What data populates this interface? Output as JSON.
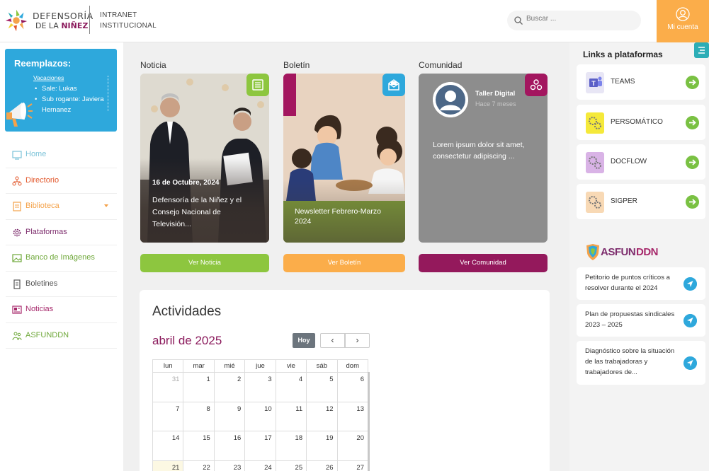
{
  "header": {
    "logo_line1": "DEFENSORÍA",
    "logo_line2_a": "DE LA",
    "logo_line2_b": "NIÑEZ",
    "intranet_line1": "INTRANET",
    "intranet_line2": "INSTITUCIONAL",
    "search_placeholder": "Buscar ...",
    "account_label": "Mi cuenta"
  },
  "reemplazos": {
    "title": "Reemplazos:",
    "subtitle": "Vacaciones",
    "items": [
      "Sale: Lukas",
      "Sub rogante: Javiera Hernanez"
    ]
  },
  "nav": {
    "items": [
      {
        "label": "Home",
        "color": "#7cc3d8"
      },
      {
        "label": "Directorio",
        "color": "#e2572b"
      },
      {
        "label": "Biblioteca",
        "color": "#f4a24a"
      },
      {
        "label": "Plataformas",
        "color": "#7d2d6d"
      },
      {
        "label": "Banco de Imágenes",
        "color": "#6fa83a"
      },
      {
        "label": "Boletines",
        "color": "#555555"
      },
      {
        "label": "Noticias",
        "color": "#a6276a"
      },
      {
        "label": "ASFUNDDN",
        "color": "#6fa83a"
      }
    ]
  },
  "cards": {
    "news": {
      "label": "Noticia",
      "date": "16 de Octubre, 2024",
      "title": "Defensoría de la Niñez y el Consejo Nacional de Televisión...",
      "button": "Ver Noticia",
      "color": "#8dc63f"
    },
    "boletin": {
      "label": "Boletín",
      "title": "Newsletter Febrero-Marzo 2024",
      "button": "Ver Boletín",
      "color": "#fbad4a"
    },
    "comunidad": {
      "label": "Comunidad",
      "author": "Taller Digital",
      "time": "Hace 7 meses",
      "text": "Lorem ipsum dolor sit amet, consectetur adipiscing ...",
      "button": "Ver Comunidad",
      "color": "#94195c"
    }
  },
  "activities": {
    "title": "Actividades",
    "month": "abril de 2025",
    "today": "Hoy",
    "prev": "‹",
    "next": "›",
    "weekdays": [
      "lun",
      "mar",
      "mié",
      "jue",
      "vie",
      "sáb",
      "dom"
    ],
    "weeks": [
      [
        "31",
        "1",
        "2",
        "3",
        "4",
        "5",
        "6"
      ],
      [
        "7",
        "8",
        "9",
        "10",
        "11",
        "12",
        "13"
      ],
      [
        "14",
        "15",
        "16",
        "17",
        "18",
        "19",
        "20"
      ],
      [
        "21",
        "22",
        "23",
        "24",
        "25",
        "26",
        "27"
      ]
    ]
  },
  "right": {
    "title": "Links a plataformas",
    "platforms": [
      {
        "label": "TEAMS",
        "color": "#e8e6f5"
      },
      {
        "label": "PERSOMÁTICO",
        "color": "#f5e93a"
      },
      {
        "label": "DOCFLOW",
        "color": "#d9b3e6"
      },
      {
        "label": "SIGPER",
        "color": "#f8d9b5"
      }
    ],
    "asfun_logo_a": "ASFUN",
    "asfun_logo_b": "DDN",
    "docs": [
      "Petitorio de puntos críticos a resolver durante el 2024",
      "Plan de propuestas sindicales 2023 – 2025",
      "Diagnóstico sobre la situación de las trabajadoras y trabajadores de..."
    ]
  }
}
